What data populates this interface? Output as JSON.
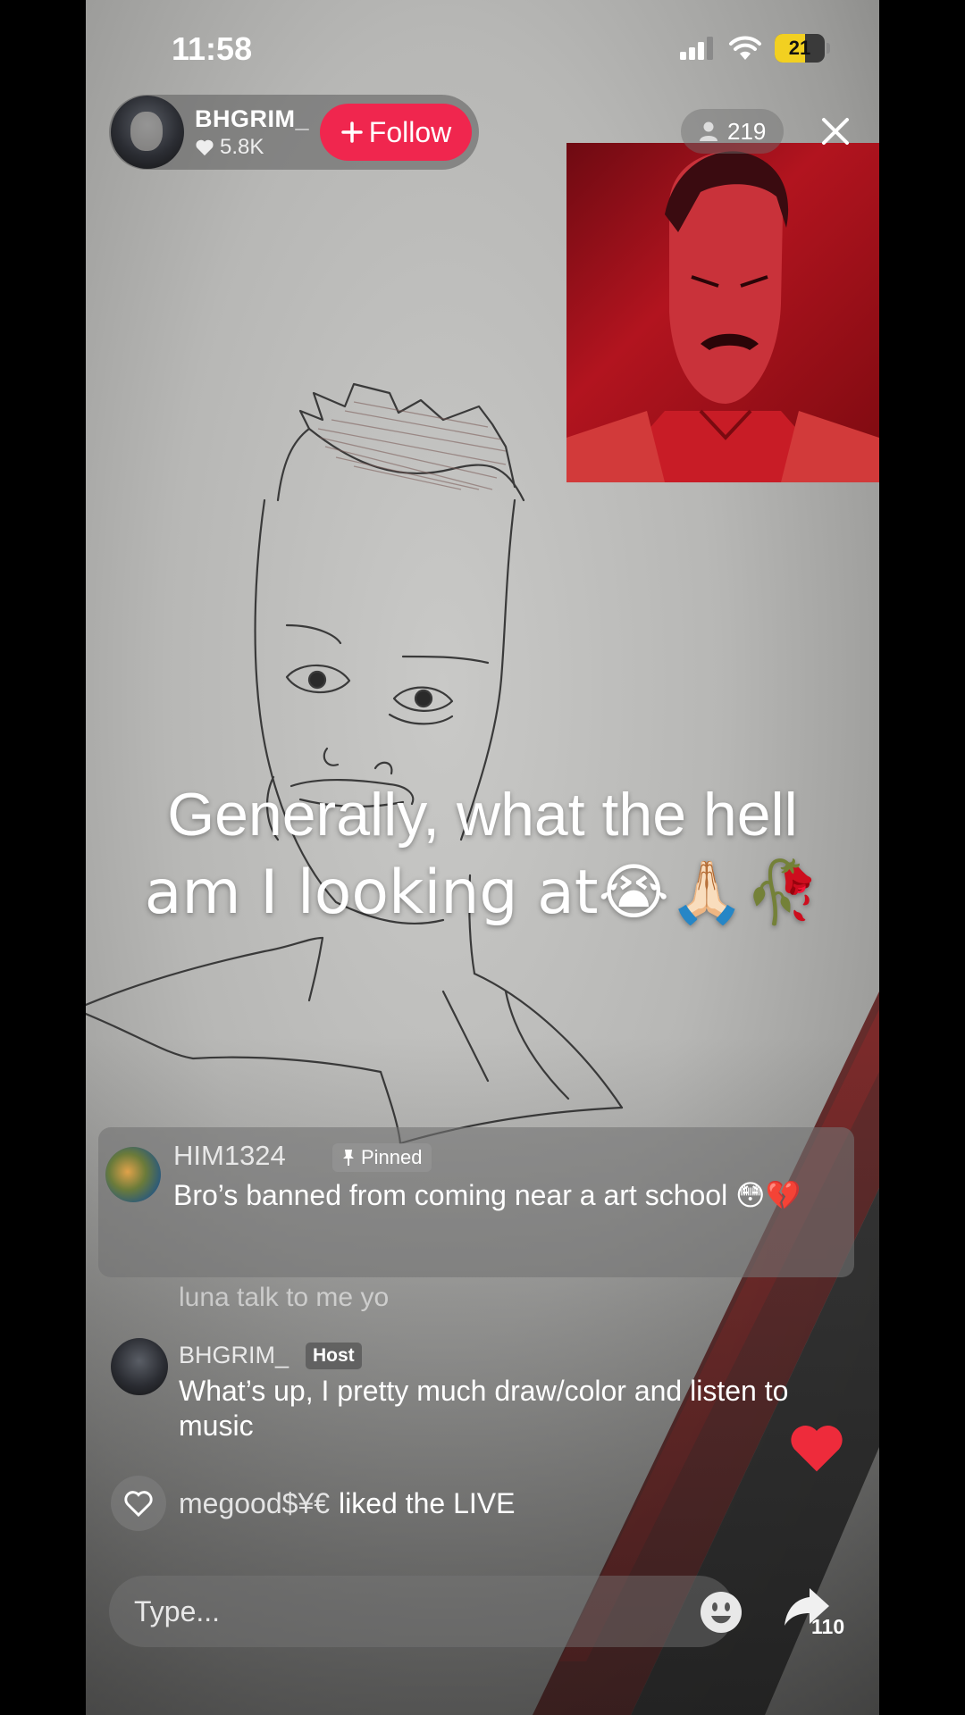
{
  "status_bar": {
    "time": "11:58",
    "battery": "21"
  },
  "host": {
    "name": "BHGRIM_",
    "likes": "5.8K",
    "follow_label": "Follow"
  },
  "viewers": {
    "count": "219"
  },
  "headline": {
    "line1": "Generally, what the hell",
    "line2": "am I looking at😭🙏🏻🥀"
  },
  "pinned_comment": {
    "user": "HIM1324",
    "badge": "Pinned",
    "text": "Bro’s banned from coming near a art school 😳💔"
  },
  "faded_comment": {
    "text": "luna talk to me yo"
  },
  "host_comment": {
    "user": "BHGRIM_",
    "badge": "Host",
    "text": "What’s up, I pretty much draw/color and listen to music"
  },
  "like_event": {
    "user": "megood$¥€",
    "action": "liked the LIVE"
  },
  "input": {
    "placeholder": "Type..."
  },
  "share": {
    "count": "110"
  },
  "colors": {
    "follow": "#f0264e",
    "battery": "#f2d021",
    "heart": "#ee2b3b"
  }
}
